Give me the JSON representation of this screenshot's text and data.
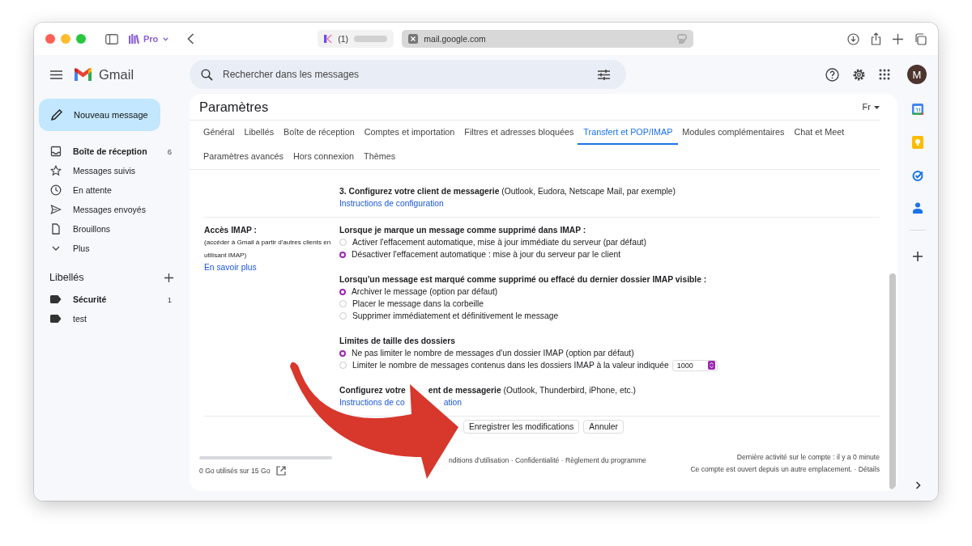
{
  "browser": {
    "profile": "Pro",
    "tabs": [
      {
        "label": "(1)",
        "selected": false
      },
      {
        "label": "mail.google.com",
        "selected": true
      }
    ]
  },
  "header": {
    "app_name": "Gmail",
    "search": {
      "placeholder": "Rechercher dans les messages"
    },
    "avatar": "M"
  },
  "compose": "Nouveau message",
  "sidebar": {
    "items": [
      {
        "label": "Boîte de réception",
        "count": "6",
        "unread": true
      },
      {
        "label": "Messages suivis",
        "unread": false
      },
      {
        "label": "En attente",
        "unread": false
      },
      {
        "label": "Messages envoyés",
        "unread": false
      },
      {
        "label": "Brouillons",
        "unread": false
      },
      {
        "label": "Plus",
        "unread": false
      }
    ],
    "labels_title": "Libellés",
    "labels": [
      {
        "label": "Sécurité",
        "count": "1",
        "unread": true
      },
      {
        "label": "test",
        "unread": false
      }
    ]
  },
  "settings": {
    "title": "Paramètres",
    "input_tool": "Fr",
    "tabs": [
      {
        "label": "Général",
        "selected": false
      },
      {
        "label": "Libellés",
        "selected": false
      },
      {
        "label": "Boîte de réception",
        "selected": false
      },
      {
        "label": "Comptes et importation",
        "selected": false
      },
      {
        "label": "Filtres et adresses bloquées",
        "selected": false
      },
      {
        "label": "Transfert et POP/IMAP",
        "selected": true
      },
      {
        "label": "Modules complémentaires",
        "selected": false
      },
      {
        "label": "Chat et Meet",
        "selected": false
      },
      {
        "label": "Paramètres avancés",
        "selected": false
      },
      {
        "label": "Hors connexion",
        "selected": false
      },
      {
        "label": "Thèmes",
        "selected": false
      }
    ],
    "pop_step": {
      "text": "**3. Configurez votre client de messagerie** (Outlook, Eudora, Netscape Mail, par exemple)",
      "link": "Instructions de configuration"
    },
    "imap": {
      "label": "Accès IMAP :",
      "note": "(accéder à Gmail à partir d'autres clients en utilisant IMAP)",
      "link": "En savoir plus",
      "groups": [
        {
          "title": "Lorsque je marque un message comme supprimé dans IMAP :",
          "options": [
            {
              "label": "Activer l'effacement automatique, mise à jour immédiate du serveur (par défaut)",
              "selected": false
            },
            {
              "label": "Désactiver l'effacement automatique : mise à jour du serveur par le client",
              "selected": true
            }
          ]
        },
        {
          "title": "Lorsqu'un message est marqué comme supprimé ou effacé du dernier dossier IMAP visible :",
          "options": [
            {
              "label": "Archiver le message (option par défaut)",
              "selected": true
            },
            {
              "label": "Placer le message dans la corbeille",
              "selected": false
            },
            {
              "label": "Supprimer immédiatement et définitivement le message",
              "selected": false
            }
          ]
        },
        {
          "title": "Limites de taille des dossiers",
          "options": [
            {
              "label": "Ne pas limiter le nombre de messages d'un dossier IMAP (option par défaut)",
              "selected": true
            },
            {
              "label": "Limiter le nombre de messages contenus dans les dossiers IMAP à la valeur indiquée",
              "selected": false,
              "value": "1000"
            }
          ]
        }
      ],
      "client_setup": {
        "heading_parts": [
          "Configurez votre",
          "ent de messagerie"
        ],
        "detail": "(Outlook, Thunderbird, iPhone, etc.)",
        "link_parts": [
          "Instructions de co",
          "ation"
        ]
      }
    },
    "buttons": [
      "Enregistrer les modifications",
      "Annuler"
    ]
  },
  "footer": {
    "storage": {
      "level": 0,
      "text": "0 Go utilisés sur 15 Go"
    },
    "terms": "nditions d'utilisation · Confidentialité · Règlement du programme",
    "activity": "Dernière activité sur le compte : il y a 0 minute",
    "session_note": "Ce compte est ouvert depuis un autre emplacement. ·",
    "details_link": "Détails"
  }
}
